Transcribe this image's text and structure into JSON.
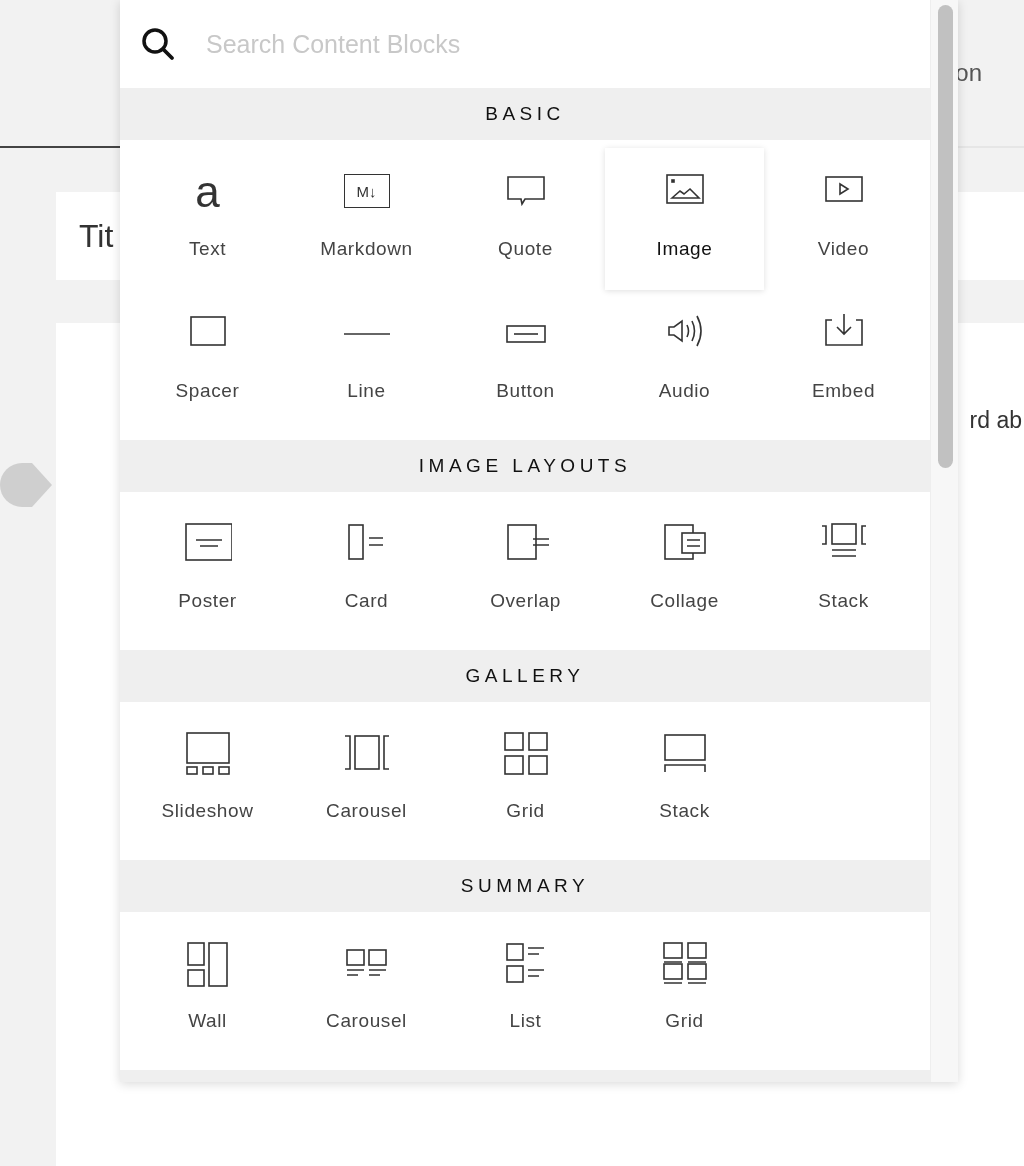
{
  "background": {
    "header_fragment": "on",
    "title_fragment": "Tit",
    "body_fragment": "rd ab"
  },
  "search": {
    "placeholder": "Search Content Blocks"
  },
  "sections": [
    {
      "title": "BASIC",
      "items": [
        {
          "label": "Text",
          "kind": "text",
          "glyph": "a",
          "selected": false
        },
        {
          "label": "Markdown",
          "kind": "markdown",
          "glyph": "M↓",
          "selected": false
        },
        {
          "label": "Quote",
          "kind": "quote",
          "selected": false
        },
        {
          "label": "Image",
          "kind": "image",
          "selected": true
        },
        {
          "label": "Video",
          "kind": "video",
          "selected": false
        },
        {
          "label": "Spacer",
          "kind": "spacer",
          "selected": false
        },
        {
          "label": "Line",
          "kind": "line",
          "selected": false
        },
        {
          "label": "Button",
          "kind": "button",
          "selected": false
        },
        {
          "label": "Audio",
          "kind": "audio",
          "selected": false
        },
        {
          "label": "Embed",
          "kind": "embed",
          "selected": false
        }
      ]
    },
    {
      "title": "IMAGE LAYOUTS",
      "items": [
        {
          "label": "Poster",
          "kind": "poster",
          "selected": false
        },
        {
          "label": "Card",
          "kind": "card",
          "selected": false
        },
        {
          "label": "Overlap",
          "kind": "overlap",
          "selected": false
        },
        {
          "label": "Collage",
          "kind": "collage",
          "selected": false
        },
        {
          "label": "Stack",
          "kind": "stack-layout",
          "selected": false
        }
      ]
    },
    {
      "title": "GALLERY",
      "items": [
        {
          "label": "Slideshow",
          "kind": "slideshow",
          "selected": false
        },
        {
          "label": "Carousel",
          "kind": "carousel-gallery",
          "selected": false
        },
        {
          "label": "Grid",
          "kind": "grid-gallery",
          "selected": false
        },
        {
          "label": "Stack",
          "kind": "stack-gallery",
          "selected": false
        }
      ]
    },
    {
      "title": "SUMMARY",
      "items": [
        {
          "label": "Wall",
          "kind": "wall",
          "selected": false
        },
        {
          "label": "Carousel",
          "kind": "carousel-summary",
          "selected": false
        },
        {
          "label": "List",
          "kind": "list",
          "selected": false
        },
        {
          "label": "Grid",
          "kind": "grid-summary",
          "selected": false
        }
      ]
    }
  ]
}
